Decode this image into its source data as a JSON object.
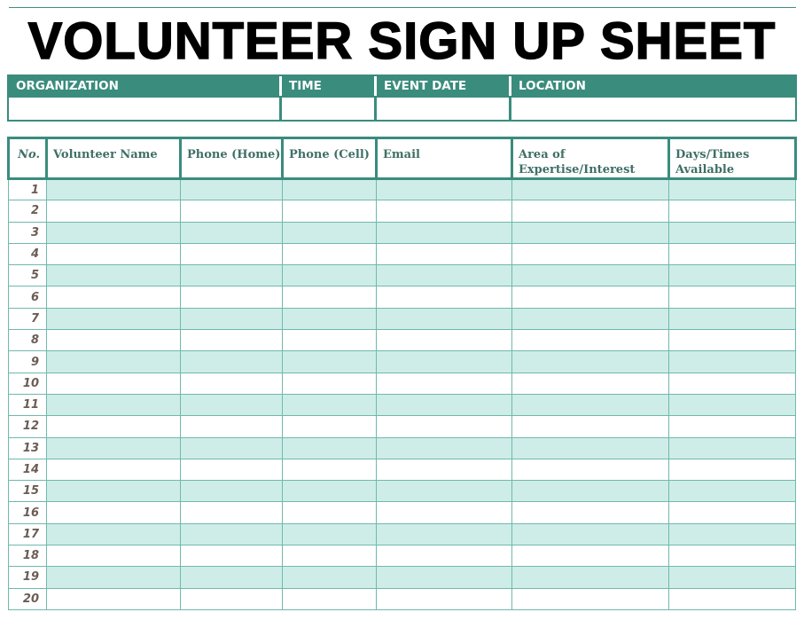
{
  "title": "VOLUNTEER SIGN UP SHEET",
  "info": {
    "headers": [
      "ORGANIZATION",
      "TIME",
      "EVENT DATE",
      "LOCATION"
    ],
    "values": [
      "",
      "",
      "",
      ""
    ]
  },
  "table": {
    "columns": [
      "No.",
      "Volunteer Name",
      "Phone (Home)",
      "Phone (Cell)",
      "Email",
      "Area of Expertise/Interest",
      "Days/Times Available"
    ],
    "rows": [
      {
        "no": "1"
      },
      {
        "no": "2"
      },
      {
        "no": "3"
      },
      {
        "no": "4"
      },
      {
        "no": "5"
      },
      {
        "no": "6"
      },
      {
        "no": "7"
      },
      {
        "no": "8"
      },
      {
        "no": "9"
      },
      {
        "no": "10"
      },
      {
        "no": "11"
      },
      {
        "no": "12"
      },
      {
        "no": "13"
      },
      {
        "no": "14"
      },
      {
        "no": "15"
      },
      {
        "no": "16"
      },
      {
        "no": "17"
      },
      {
        "no": "18"
      },
      {
        "no": "19"
      },
      {
        "no": "20"
      }
    ]
  },
  "colors": {
    "accent": "#3a8c7d",
    "row_band": "#cfede8",
    "header_text": "#3f6f66",
    "number_text": "#6a5d55"
  }
}
